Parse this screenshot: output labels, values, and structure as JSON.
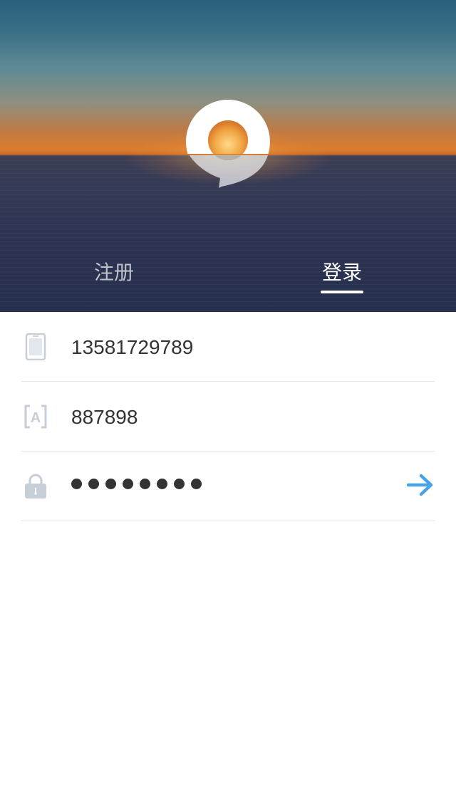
{
  "tabs": {
    "register_label": "注册",
    "login_label": "登录",
    "active": "login"
  },
  "form": {
    "phone": {
      "icon": "phone-icon",
      "value": "13581729789"
    },
    "captcha": {
      "icon": "captcha-icon",
      "value": "887898"
    },
    "password": {
      "icon": "lock-icon",
      "masked_length": 8,
      "submit_icon": "arrow-right-icon"
    }
  },
  "colors": {
    "accent": "#4aa3e8",
    "text": "#333333",
    "icon_gray": "#c6ced8",
    "divider": "#e6e6e6"
  }
}
